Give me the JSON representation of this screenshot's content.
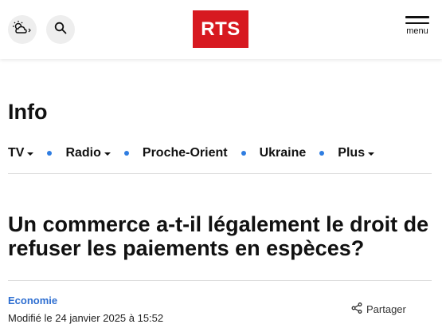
{
  "header": {
    "logo_text": "RTS",
    "menu_label": "menu",
    "weather_icon": "weather-partly-cloudy-icon",
    "search_icon": "search-icon"
  },
  "section": {
    "title": "Info"
  },
  "subnav": {
    "items": [
      {
        "label": "TV",
        "dropdown": true
      },
      {
        "label": "Radio",
        "dropdown": true
      },
      {
        "label": "Proche-Orient",
        "dropdown": false
      },
      {
        "label": "Ukraine",
        "dropdown": false
      },
      {
        "label": "Plus",
        "dropdown": true
      }
    ],
    "separator_color": "#2f7de1"
  },
  "article": {
    "headline": "Un commerce a-t-il légalement le droit de refuser les paiements en espèces?",
    "category": "Economie",
    "modified": "Modifié le 24 janvier 2025 à 15:52",
    "share_label": "Partager"
  },
  "colors": {
    "brand": "#d71920",
    "accent": "#2f6fd1"
  }
}
